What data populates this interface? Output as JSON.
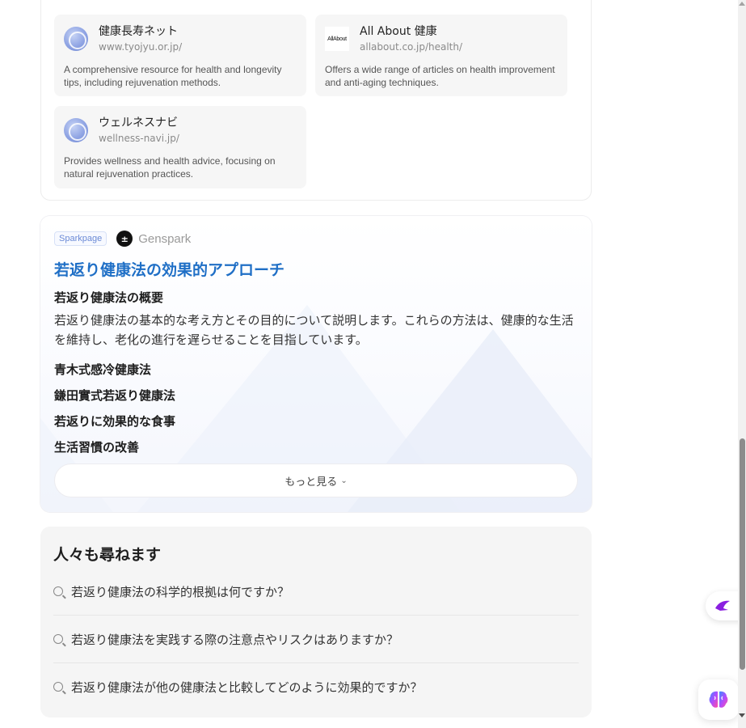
{
  "sources": [
    {
      "title": "健康長寿ネット",
      "url": "www.tyojyu.or.jp/",
      "desc": "A comprehensive resource for health and longevity tips, including rejuvenation methods.",
      "icon": "globe-icon"
    },
    {
      "title": "All About 健康",
      "url": "allabout.co.jp/health/",
      "desc": "Offers a wide range of articles on health improvement and anti-aging techniques.",
      "icon": "allabout-logo",
      "icon_text": "AllAbout"
    },
    {
      "title": "ウェルネスナビ",
      "url": "wellness-navi.jp/",
      "desc": "Provides wellness and health advice, focusing on natural rejuvenation practices.",
      "icon": "globe-icon"
    }
  ],
  "sparkpage": {
    "badge": "Sparkpage",
    "brand": "Genspark",
    "brand_logo_glyph": "±",
    "title": "若返り健康法の効果的アプローチ",
    "overview_heading": "若返り健康法の概要",
    "overview_text": "若返り健康法の基本的な考え方とその目的について説明します。これらの方法は、健康的な生活を維持し、老化の進行を遅らせることを目指しています。",
    "sections": [
      "青木式感冷健康法",
      "鎌田實式若返り健康法",
      "若返りに効果的な食事",
      "生活習慣の改善"
    ],
    "more_label": "もっと見る"
  },
  "faq": {
    "title": "人々も尋ねます",
    "items": [
      "若返り健康法の科学的根拠は何ですか？",
      "若返り健康法を実践する際の注意点やリスクはありますか？",
      "若返り健康法が他の健康法と比較してどのように効果的ですか？"
    ]
  },
  "colors": {
    "accent_title": "#1f6fc6",
    "panel_bg": "#f5f5f5",
    "card_bg": "#f6f6f6"
  }
}
